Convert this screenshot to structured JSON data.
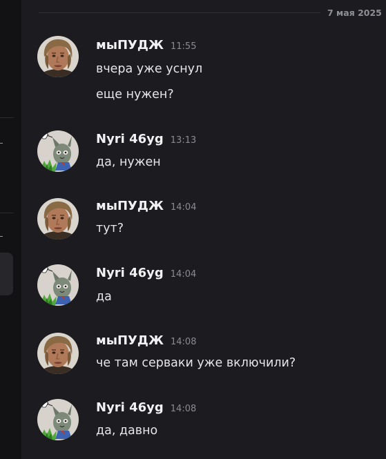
{
  "date_divider": "7 мая 2025",
  "messages": [
    {
      "author": "мыПУДЖ",
      "time": "11:55",
      "avatar": "man-photo-avatar",
      "lines": [
        "вчера уже уснул",
        "еще нужен?"
      ]
    },
    {
      "author": "Nyri 46yg",
      "time": "13:13",
      "avatar": "cartoon-cat-avatar",
      "lines": [
        "да, нужен"
      ]
    },
    {
      "author": "мыПУДЖ",
      "time": "14:04",
      "avatar": "man-photo-avatar",
      "lines": [
        "тут?"
      ]
    },
    {
      "author": "Nyri 46yg",
      "time": "14:04",
      "avatar": "cartoon-cat-avatar",
      "lines": [
        "да"
      ]
    },
    {
      "author": "мыПУДЖ",
      "time": "14:08",
      "avatar": "man-photo-avatar",
      "lines": [
        "че там серваки уже включили?"
      ]
    },
    {
      "author": "Nyri 46yg",
      "time": "14:08",
      "avatar": "cartoon-cat-avatar",
      "lines": [
        "да, давно"
      ]
    }
  ]
}
